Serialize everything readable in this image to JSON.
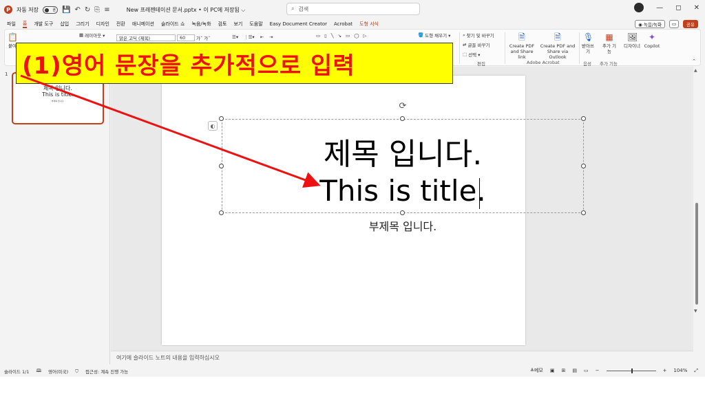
{
  "titlebar": {
    "autosave_label": "자동 저장",
    "autosave_state": "끔",
    "document_title": "New 프레젠테이션 문서.pptx • 이 PC에 저장됨 ⌵",
    "search_placeholder": "검색",
    "minimize": "—",
    "restore": "◻",
    "close": "✕"
  },
  "menu": {
    "tabs": [
      "파일",
      "홈",
      "개발 도구",
      "삽입",
      "그리기",
      "디자인",
      "전환",
      "애니메이션",
      "슬라이드 쇼",
      "녹음/녹화",
      "검토",
      "보기",
      "도움말",
      "Easy Document Creator",
      "Acrobat",
      "도형 서식"
    ],
    "active_tab": "홈",
    "record_label": "◉ 녹음/녹화",
    "share_label": "공유"
  },
  "ribbon": {
    "paste_label": "붙여",
    "layout_label": "레이아웃 ▾",
    "font_name": "맑은 고딕 (제목)",
    "font_size": "60",
    "shape_fill_label": "도형 채우기 ▾",
    "find_label": "찾기 및 바꾸기",
    "replace_label": "글꼴 바꾸기",
    "select_label": "선택 ▾",
    "edit_group": "편집",
    "create_pdf_share": "Create PDF and Share link",
    "create_pdf_outlook": "Create PDF and Share via Outlook",
    "adobe_group": "Adobe Acrobat",
    "dictate_label": "받아쓰기",
    "voice_group": "음성",
    "addins_label": "추가 기능",
    "addins_group": "추가 기능",
    "designer_label": "디자이너",
    "copilot_label": "Copilot"
  },
  "thumbnail": {
    "number": "1",
    "title": "제목 입니다.\nThis is title.",
    "subtitle": "부제목 입니다."
  },
  "slide": {
    "title_line1": "제목 입니다.",
    "title_line2": "This is title.",
    "subtitle": "부제목 입니다."
  },
  "notes_placeholder": "여기에 슬라이드 노트의 내용을 입력하십시오",
  "statusbar": {
    "slide_counter": "슬라이드 1/1",
    "language": "영어(미국)",
    "accessibility": "접근성: 계속 진행 가능",
    "notes_label": "≜메모",
    "zoom_level": "104%"
  },
  "annotation": {
    "callout_text": "(1)영어 문장을 추가적으로 입력",
    "color": "#ee1111"
  },
  "colors": {
    "accent": "#c43e1c",
    "callout_bg": "#ffff00"
  }
}
